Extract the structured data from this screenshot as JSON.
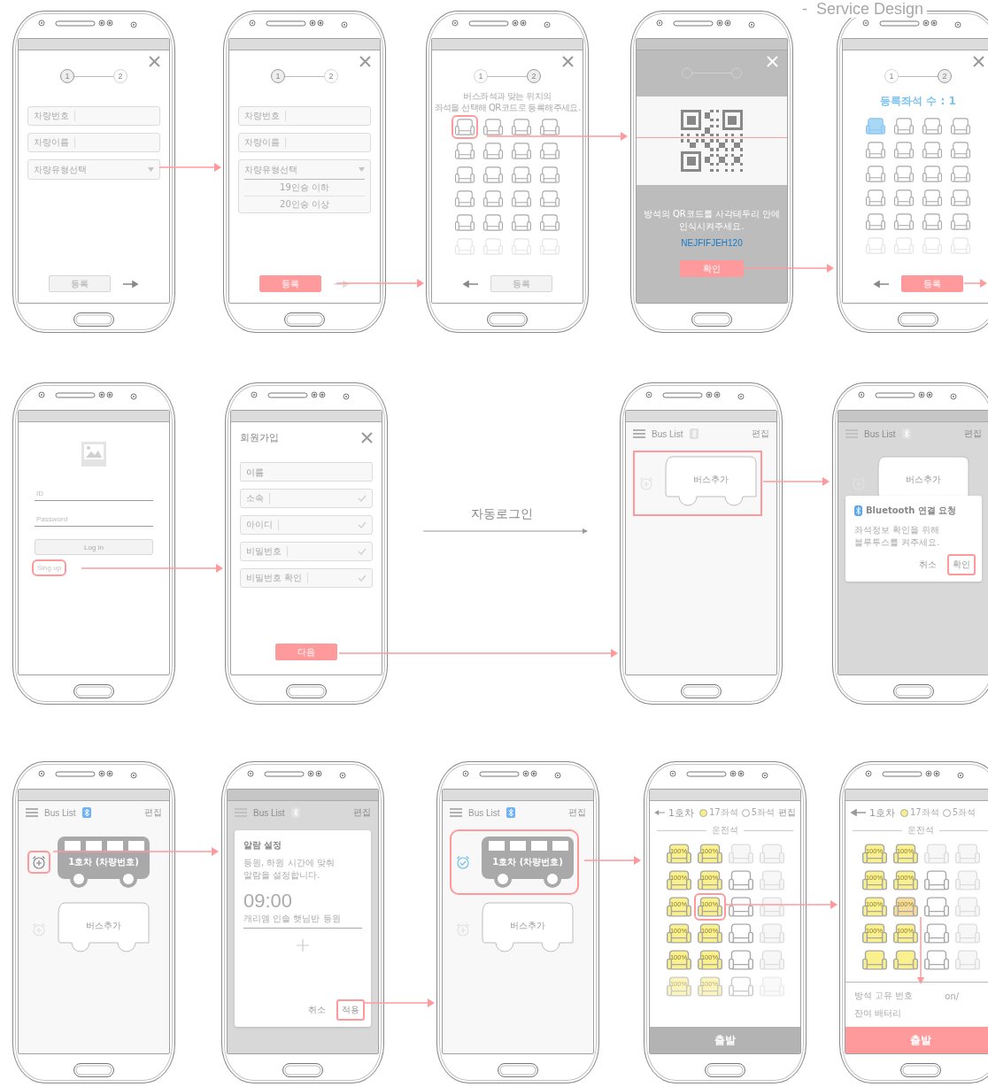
{
  "title": "-  Service Design",
  "rows": [
    {
      "phones": [
        {
          "kind": "vehicle_form",
          "steps": [
            {
              "label": "1",
              "selected": true
            },
            {
              "label": "2",
              "selected": false
            }
          ],
          "fields": [
            "차량번호",
            "차량이름"
          ],
          "select": {
            "label": "차량유형선택",
            "expanded": false
          },
          "register": {
            "label": "등록",
            "active": false
          }
        },
        {
          "kind": "vehicle_form",
          "steps": [
            {
              "label": "1",
              "selected": true
            },
            {
              "label": "2",
              "selected": false
            }
          ],
          "fields": [
            "차량번호",
            "차량이름"
          ],
          "select": {
            "label": "차량유형선택",
            "expanded": true,
            "options": [
              "19인승 이하",
              "20인승 이상"
            ]
          },
          "register": {
            "label": "등록",
            "active": true
          }
        },
        {
          "kind": "seat_select",
          "steps": [
            {
              "label": "1",
              "selected": false
            },
            {
              "label": "2",
              "selected": true
            }
          ],
          "instruction_lines": [
            "버스좌석과 맞는 위치의",
            "좌석을 선택해 QR코드로 등록해주세요."
          ],
          "seat_rows": [
            [
              {
                "kind": "empty",
                "highlighted": true
              },
              {
                "kind": "empty"
              },
              {
                "kind": "empty"
              },
              {
                "kind": "empty"
              }
            ],
            [
              {
                "kind": "empty"
              },
              {
                "kind": "empty"
              },
              {
                "kind": "empty"
              },
              {
                "kind": "empty"
              }
            ],
            [
              {
                "kind": "empty"
              },
              {
                "kind": "empty"
              },
              {
                "kind": "empty"
              },
              {
                "kind": "empty"
              }
            ],
            [
              {
                "kind": "empty"
              },
              {
                "kind": "empty"
              },
              {
                "kind": "empty"
              },
              {
                "kind": "empty"
              }
            ],
            [
              {
                "kind": "empty"
              },
              {
                "kind": "empty"
              },
              {
                "kind": "empty"
              },
              {
                "kind": "empty"
              }
            ],
            [
              {
                "kind": "faded"
              },
              {
                "kind": "faded"
              },
              {
                "kind": "faded"
              },
              {
                "kind": "faded"
              }
            ]
          ],
          "register": {
            "label": "등록",
            "active": false
          }
        },
        {
          "kind": "qr_scan",
          "message_lines": [
            "방석의 QR코드를 사각테두리 안에",
            "인식시켜주세요."
          ],
          "code": "NEJFIFJEH120",
          "confirm": {
            "label": "확인",
            "active": true
          }
        },
        {
          "kind": "seat_select",
          "steps": [
            {
              "label": "1",
              "selected": false
            },
            {
              "label": "2",
              "selected": true
            }
          ],
          "count_label": "등록좌석 수 : 1",
          "seat_rows": [
            [
              {
                "kind": "registered"
              },
              {
                "kind": "empty"
              },
              {
                "kind": "empty"
              },
              {
                "kind": "empty"
              }
            ],
            [
              {
                "kind": "empty"
              },
              {
                "kind": "empty"
              },
              {
                "kind": "empty"
              },
              {
                "kind": "empty"
              }
            ],
            [
              {
                "kind": "empty"
              },
              {
                "kind": "empty"
              },
              {
                "kind": "empty"
              },
              {
                "kind": "empty"
              }
            ],
            [
              {
                "kind": "empty"
              },
              {
                "kind": "empty"
              },
              {
                "kind": "empty"
              },
              {
                "kind": "empty"
              }
            ],
            [
              {
                "kind": "empty"
              },
              {
                "kind": "empty"
              },
              {
                "kind": "empty"
              },
              {
                "kind": "empty"
              }
            ],
            [
              {
                "kind": "faded"
              },
              {
                "kind": "faded"
              },
              {
                "kind": "faded"
              },
              {
                "kind": "faded"
              }
            ]
          ],
          "register": {
            "label": "등록",
            "active": true
          }
        }
      ]
    },
    {
      "transition_label": "자동로그인",
      "phones": [
        {
          "kind": "login",
          "fields": [
            {
              "placeholder": "ID"
            },
            {
              "placeholder": "Password"
            }
          ],
          "login_button": "Log in",
          "signup_link": {
            "label": "Sing up",
            "highlighted": true
          }
        },
        {
          "kind": "signup",
          "title": "회원가입",
          "fields": [
            {
              "placeholder": "이름"
            },
            {
              "label": "소속"
            },
            {
              "label": "아이디"
            },
            {
              "label": "비밀번호"
            },
            {
              "label": "비밀번호 확인"
            }
          ],
          "next_button": "다음"
        },
        {
          "kind": "bus_list",
          "title": "Bus List",
          "bluetooth_on": false,
          "edit_label": "편집",
          "dimmed": false,
          "buses": [
            {
              "kind": "add",
              "label": "버스추가",
              "highlighted": true
            }
          ]
        },
        {
          "kind": "bus_list",
          "title": "Bus List",
          "bluetooth_on": false,
          "edit_label": "편집",
          "dimmed": true,
          "buses": [
            {
              "kind": "add",
              "label": "버스추가",
              "highlighted": false
            }
          ],
          "dialog": {
            "kind": "bluetooth",
            "title": "Bluetooth 연결 요청",
            "lines": [
              "좌석정보 확인을 위해",
              "블루투스를 켜주세요."
            ],
            "buttons": [
              {
                "label": "취소",
                "highlighted": false
              },
              {
                "label": "확인",
                "highlighted": true
              }
            ]
          }
        }
      ]
    },
    {
      "phones": [
        {
          "kind": "bus_list",
          "title": "Bus List",
          "bluetooth_on": true,
          "edit_label": "편집",
          "dimmed": false,
          "buses": [
            {
              "kind": "bus",
              "label": "1호차 (차량번호)",
              "alarm": {
                "kind": "add",
                "highlighted": true
              },
              "highlighted": false
            },
            {
              "kind": "add",
              "label": "버스추가",
              "highlighted": false
            }
          ]
        },
        {
          "kind": "bus_list",
          "title": "Bus List",
          "bluetooth_on": false,
          "edit_label": "편집",
          "dimmed": true,
          "dialog": {
            "kind": "alarm",
            "title": "알람 설정",
            "description": "등원, 하원 시간에 맞춰 알람을 설정합니다.",
            "time": "09:00",
            "note": "캐리엠 인솔 햇님반 등원",
            "buttons": [
              {
                "label": "취소",
                "highlighted": false
              },
              {
                "label": "적용",
                "highlighted": true
              }
            ]
          }
        },
        {
          "kind": "bus_list",
          "title": "Bus List",
          "bluetooth_on": true,
          "edit_label": "편집",
          "dimmed": false,
          "buses": [
            {
              "kind": "bus",
              "label": "1호차 (차량번호)",
              "alarm": {
                "kind": "set",
                "highlighted": false
              },
              "highlighted": true
            },
            {
              "kind": "add",
              "label": "버스추가",
              "highlighted": false
            }
          ]
        },
        {
          "kind": "seat_map",
          "title": "1호차",
          "legend": [
            {
              "label": "17좌석",
              "color": "#f8ee8a"
            },
            {
              "label": "5좌석",
              "color": "#ffffff"
            }
          ],
          "edit_label": "편집",
          "driver_label": "운전석",
          "fade_last_row": true,
          "seat_rows": [
            [
              {
                "kind": "occupied",
                "label": "100%"
              },
              {
                "kind": "occupied",
                "label": "100%"
              },
              {
                "kind": "unused"
              },
              {
                "kind": "unused"
              }
            ],
            [
              {
                "kind": "occupied",
                "label": "100%"
              },
              {
                "kind": "occupied",
                "label": "100%"
              },
              {
                "kind": "empty"
              },
              {
                "kind": "unused"
              }
            ],
            [
              {
                "kind": "occupied",
                "label": "100%"
              },
              {
                "kind": "occupied",
                "label": "100%",
                "highlighted": true
              },
              {
                "kind": "empty"
              },
              {
                "kind": "unused"
              }
            ],
            [
              {
                "kind": "occupied",
                "label": "100%"
              },
              {
                "kind": "occupied",
                "label": "100%"
              },
              {
                "kind": "empty"
              },
              {
                "kind": "unused"
              }
            ],
            [
              {
                "kind": "occupied",
                "label": "100%"
              },
              {
                "kind": "occupied",
                "label": "100%"
              },
              {
                "kind": "empty"
              },
              {
                "kind": "unused"
              }
            ],
            [
              {
                "kind": "occupied",
                "label": "100%"
              },
              {
                "kind": "occupied",
                "label": "100%"
              },
              {
                "kind": "empty"
              },
              {
                "kind": "unused"
              }
            ]
          ],
          "depart": {
            "label": "출발",
            "active": false
          }
        },
        {
          "kind": "seat_map",
          "title": "1호차",
          "legend": [
            {
              "label": "17좌석",
              "color": "#f8ee8a"
            },
            {
              "label": "5좌석",
              "color": "#ffffff"
            }
          ],
          "driver_label": "운전석",
          "fade_last_row": false,
          "seat_rows": [
            [
              {
                "kind": "occupied",
                "label": "100%"
              },
              {
                "kind": "occupied",
                "label": "100%"
              },
              {
                "kind": "unused"
              },
              {
                "kind": "unused"
              }
            ],
            [
              {
                "kind": "occupied",
                "label": "100%"
              },
              {
                "kind": "occupied",
                "label": "100%"
              },
              {
                "kind": "empty"
              },
              {
                "kind": "unused"
              }
            ],
            [
              {
                "kind": "occupied",
                "label": "100%"
              },
              {
                "kind": "selected",
                "label": "100%"
              },
              {
                "kind": "empty"
              },
              {
                "kind": "unused"
              }
            ],
            [
              {
                "kind": "occupied",
                "label": "100%"
              },
              {
                "kind": "occupied",
                "label": "100%"
              },
              {
                "kind": "empty"
              },
              {
                "kind": "unused"
              }
            ],
            [
              {
                "kind": "occupied"
              },
              {
                "kind": "occupied"
              },
              {
                "kind": "empty"
              },
              {
                "kind": "unused"
              }
            ]
          ],
          "info": {
            "serial_label": "방석 고유 번호",
            "status": "on/",
            "battery_label": "잔여 배터리"
          },
          "depart": {
            "label": "출발",
            "active": true
          }
        }
      ]
    }
  ]
}
